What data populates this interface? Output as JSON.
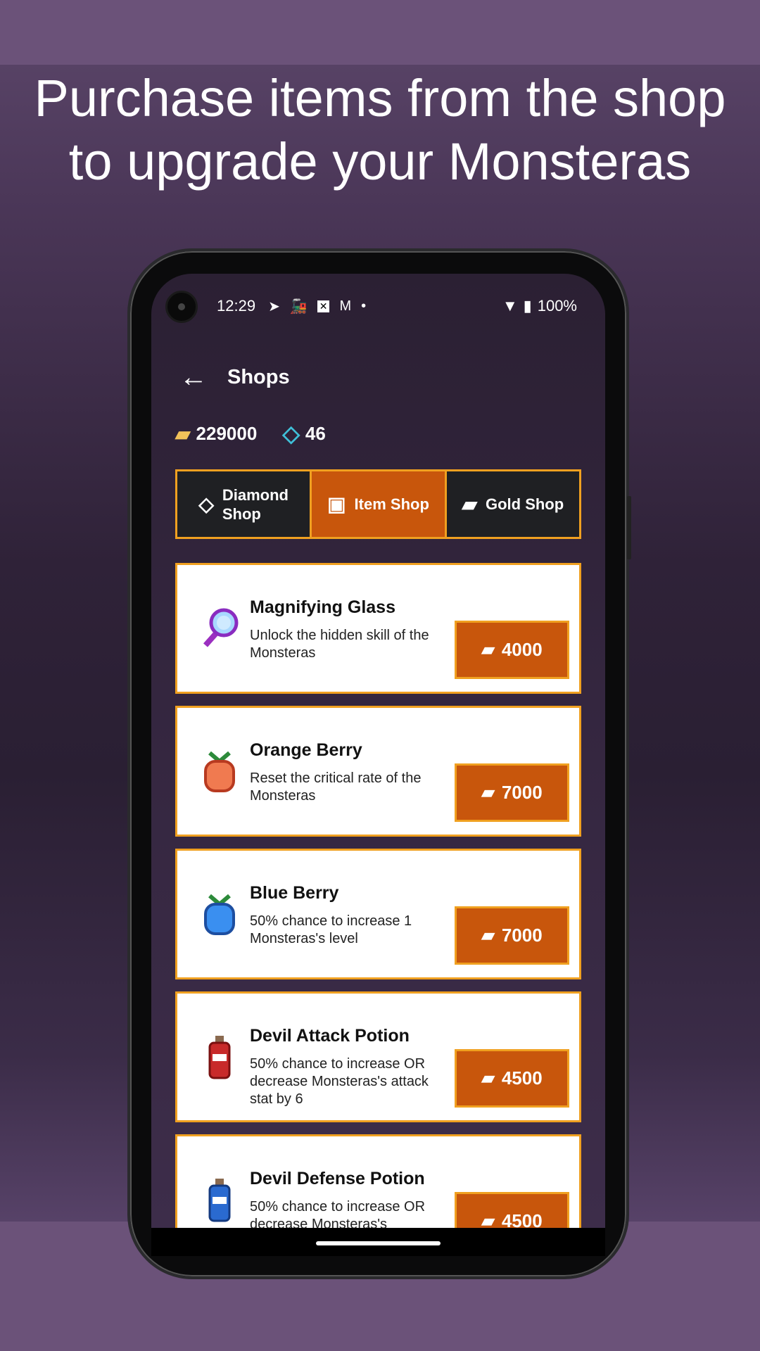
{
  "headline": {
    "line1": "Purchase items from the shop",
    "line2": "to upgrade your Monsteras"
  },
  "status": {
    "time": "12:29",
    "battery": "100%",
    "icons": [
      "telegram-icon",
      "train-icon",
      "app-icon",
      "gmail-icon",
      "dot-icon"
    ]
  },
  "appbar": {
    "title": "Shops"
  },
  "currency": {
    "gold": "229000",
    "diamonds": "46"
  },
  "tabs": [
    {
      "label_1": "Diamond",
      "label_2": "Shop",
      "icon": "diamond-icon"
    },
    {
      "label": "Item Shop",
      "icon": "backpack-icon",
      "active": true
    },
    {
      "label": "Gold Shop",
      "icon": "gold-bars-icon"
    }
  ],
  "items": [
    {
      "name": "Magnifying Glass",
      "desc": "Unlock the hidden skill of the Monsteras",
      "price": "4000",
      "icon": "magnifying-glass-icon"
    },
    {
      "name": "Orange Berry",
      "desc": "Reset the critical rate of the Monsteras",
      "price": "7000",
      "icon": "orange-berry-icon"
    },
    {
      "name": "Blue Berry",
      "desc": "50% chance to increase 1 Monsteras's level",
      "price": "7000",
      "icon": "blue-berry-icon"
    },
    {
      "name": "Devil Attack Potion",
      "desc": "50% chance to increase OR decrease Monsteras's attack stat by 6",
      "price": "4500",
      "icon": "red-potion-icon"
    },
    {
      "name": "Devil Defense Potion",
      "desc": "50% chance to increase OR decrease Monsteras's",
      "price": "4500",
      "icon": "blue-potion-icon"
    }
  ],
  "colors": {
    "accent": "#c8560c",
    "border": "#f0a020",
    "gold": "#f2c25a",
    "diamond": "#3fc0d8"
  }
}
